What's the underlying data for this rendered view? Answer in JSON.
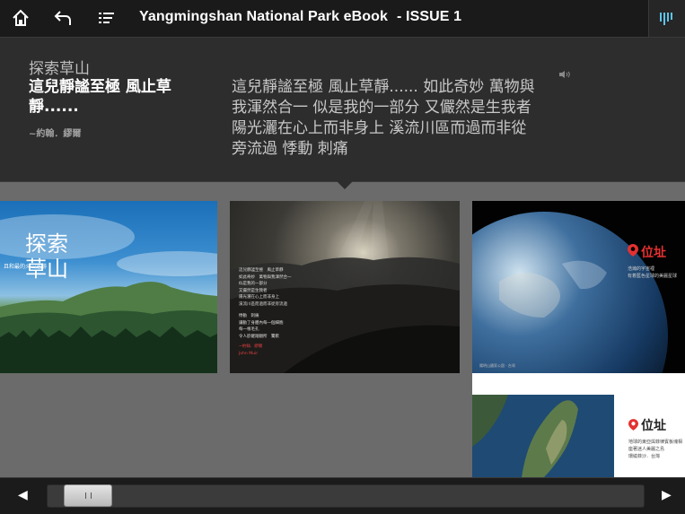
{
  "header": {
    "title": "Yangmingshan National Park eBook",
    "issue": "- ISSUE 1",
    "home_icon": "home-icon",
    "back_icon": "back-arrow-icon",
    "toc_icon": "list-icon",
    "panel_toggle_icon": "bars-icon"
  },
  "panel": {
    "title": "探索草山",
    "quote": "這兒靜謐至極 風止草靜......",
    "author": "~約翰．繆爾",
    "body": "這兒靜謐至極 風止草靜...... 如此奇妙 萬物與我渾然合一 似是我的一部分 又儼然是生我者 陽光灑在心上而非身上 溪流川區而過而非從旁流過 悸動 刺痛",
    "audio_icon": "speaker-icon"
  },
  "pages": [
    {
      "title_text": "探索草山",
      "subtitle_text": "且和最的火山遺跡"
    },
    {
      "lines": [
        "這兒靜謐至極　風止草靜",
        "如此奇妙　萬物與我渾然合一",
        "似是我的一部分",
        "又儼然是生我者",
        "陽光灑在心上而非身上",
        "溪流川區而過而非從旁流過"
      ],
      "lines2": [
        "悸動　刺痛",
        "讓動了身體內每一個細胞",
        "每一根毛孔",
        "令人欲罷踏翻所　驚歎"
      ],
      "signature": "~約翰．繆爾",
      "signature2": "John Muir"
    },
    {
      "heading": "位址",
      "text1": "浩瀚的宇宙裡",
      "text2": "有着藍色星球的美麗星球",
      "caption": "陽明山國家公園 · 台灣"
    },
    {
      "heading": "位址",
      "text1": "地球的東亞與菲律賓板塊相",
      "text2": "座著迷人美麗之島",
      "text3": "環繞菲沙．台灣"
    }
  ],
  "footer": {
    "prev_arrow": "◀",
    "next_arrow": "▶",
    "scroll_position": 0.04
  }
}
